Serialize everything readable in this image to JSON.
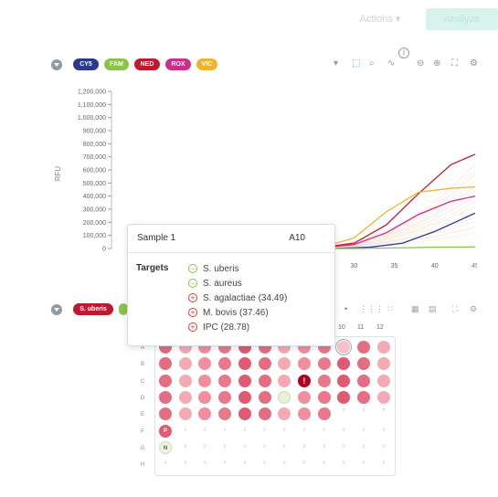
{
  "header": {
    "actions_label": "Actions ▾",
    "primary_label": "Analyze"
  },
  "dyes": [
    {
      "label": "CY5",
      "color": "#2c3a8c"
    },
    {
      "label": "FAM",
      "color": "#8bc34a"
    },
    {
      "label": "NED",
      "color": "#c0182f"
    },
    {
      "label": "ROX",
      "color": "#cc2e8a"
    },
    {
      "label": "VIC",
      "color": "#f0b429"
    }
  ],
  "chart_data": {
    "type": "line",
    "ylabel": "RFU",
    "yticks": [
      "1,200,000",
      "1,100,000",
      "1,000,000",
      "900,000",
      "800,000",
      "700,000",
      "600,000",
      "500,000",
      "400,000",
      "300,000",
      "200,000",
      "100,000",
      "0"
    ],
    "ylim": [
      0,
      1200000
    ],
    "xticks_visible": [
      "30",
      "35",
      "40",
      "45"
    ],
    "xlim": [
      0,
      45
    ],
    "series": [
      {
        "color": "#c0182f",
        "x": [
          22,
          26,
          30,
          34,
          38,
          42,
          45
        ],
        "y": [
          0,
          8000,
          40000,
          180000,
          420000,
          640000,
          720000
        ]
      },
      {
        "color": "#f0b429",
        "x": [
          22,
          26,
          30,
          34,
          38,
          42,
          45
        ],
        "y": [
          0,
          10000,
          80000,
          280000,
          430000,
          460000,
          470000
        ]
      },
      {
        "color": "#cc2e8a",
        "x": [
          22,
          26,
          30,
          34,
          38,
          42,
          45
        ],
        "y": [
          0,
          5000,
          30000,
          120000,
          260000,
          360000,
          400000
        ]
      },
      {
        "color": "#2c3a8c",
        "x": [
          22,
          28,
          32,
          36,
          40,
          45
        ],
        "y": [
          0,
          2000,
          10000,
          40000,
          130000,
          270000
        ]
      },
      {
        "color": "#8bc34a",
        "x": [
          22,
          30,
          36,
          40,
          45
        ],
        "y": [
          0,
          0,
          5000,
          10000,
          12000
        ]
      }
    ]
  },
  "tooltip": {
    "sample": "Sample 1",
    "well": "A10",
    "targets_label": "Targets",
    "targets": [
      {
        "name": "S. uberis",
        "result": "neg"
      },
      {
        "name": "S. aureus",
        "result": "neg"
      },
      {
        "name": "S. agalactiae  (34.49)",
        "result": "pos"
      },
      {
        "name": "M. bovis  (37.46)",
        "result": "pos"
      },
      {
        "name": "IPC  (28.78)",
        "result": "pos"
      }
    ]
  },
  "target_filter": {
    "label": "S. uberis",
    "color": "#c0182f"
  },
  "plate": {
    "columns_visible": [
      "10",
      "11",
      "12"
    ],
    "rows": [
      "A",
      "B",
      "C",
      "D",
      "E",
      "F",
      "G",
      "H"
    ],
    "markers": {
      "positive": "P",
      "negative": "N",
      "alert": "!"
    }
  }
}
